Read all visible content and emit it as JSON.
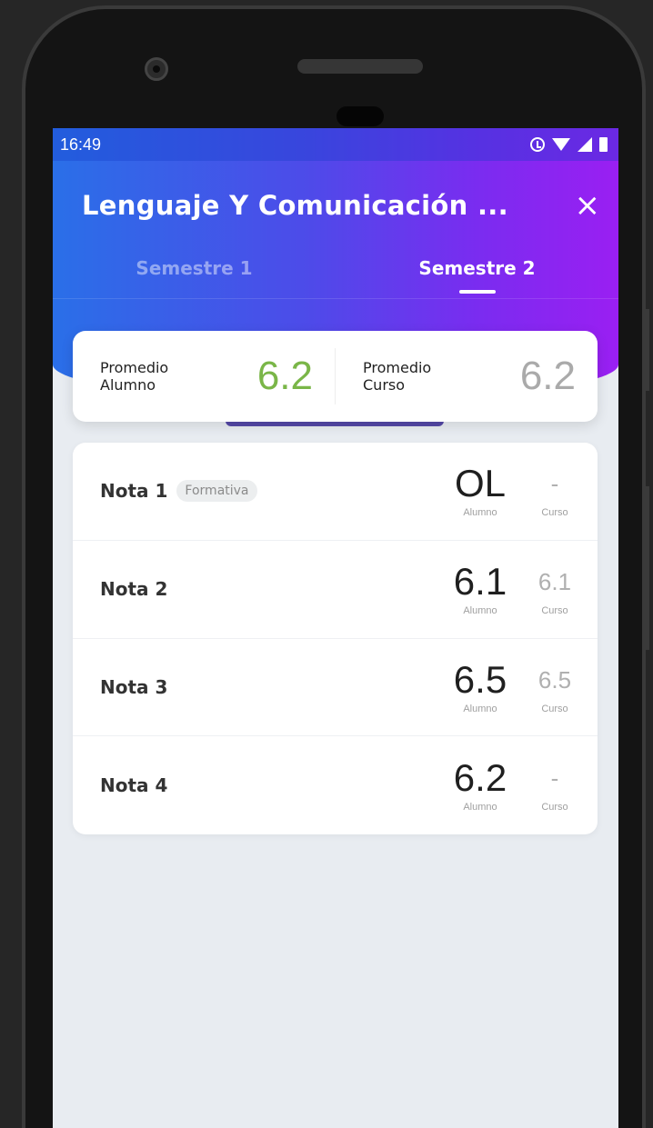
{
  "status_bar": {
    "time": "16:49",
    "icons": [
      "alarm-icon",
      "wifi-icon",
      "signal-icon",
      "battery-icon"
    ]
  },
  "header": {
    "title": "Lenguaje Y Comunicación ...",
    "close_icon": "×",
    "gradient_colors": [
      "#2a6fe8",
      "#9a1ff2"
    ]
  },
  "tabs": [
    {
      "label": "Semestre 1",
      "active": false
    },
    {
      "label": "Semestre 2",
      "active": true
    }
  ],
  "averages": {
    "student": {
      "label_line1": "Promedio",
      "label_line2": "Alumno",
      "value": "6.2",
      "color": "#7ab648"
    },
    "course": {
      "label_line1": "Promedio",
      "label_line2": "Curso",
      "value": "6.2",
      "color": "#aaaaaa"
    }
  },
  "grades": [
    {
      "name": "Nota 1",
      "badge": "Formativa",
      "student_value": "OL",
      "student_caption": "Alumno",
      "course_value": "-",
      "course_caption": "Curso"
    },
    {
      "name": "Nota 2",
      "badge": "",
      "student_value": "6.1",
      "student_caption": "Alumno",
      "course_value": "6.1",
      "course_caption": "Curso"
    },
    {
      "name": "Nota 3",
      "badge": "",
      "student_value": "6.5",
      "student_caption": "Alumno",
      "course_value": "6.5",
      "course_caption": "Curso"
    },
    {
      "name": "Nota 4",
      "badge": "",
      "student_value": "6.2",
      "student_caption": "Alumno",
      "course_value": "-",
      "course_caption": "Curso"
    }
  ]
}
